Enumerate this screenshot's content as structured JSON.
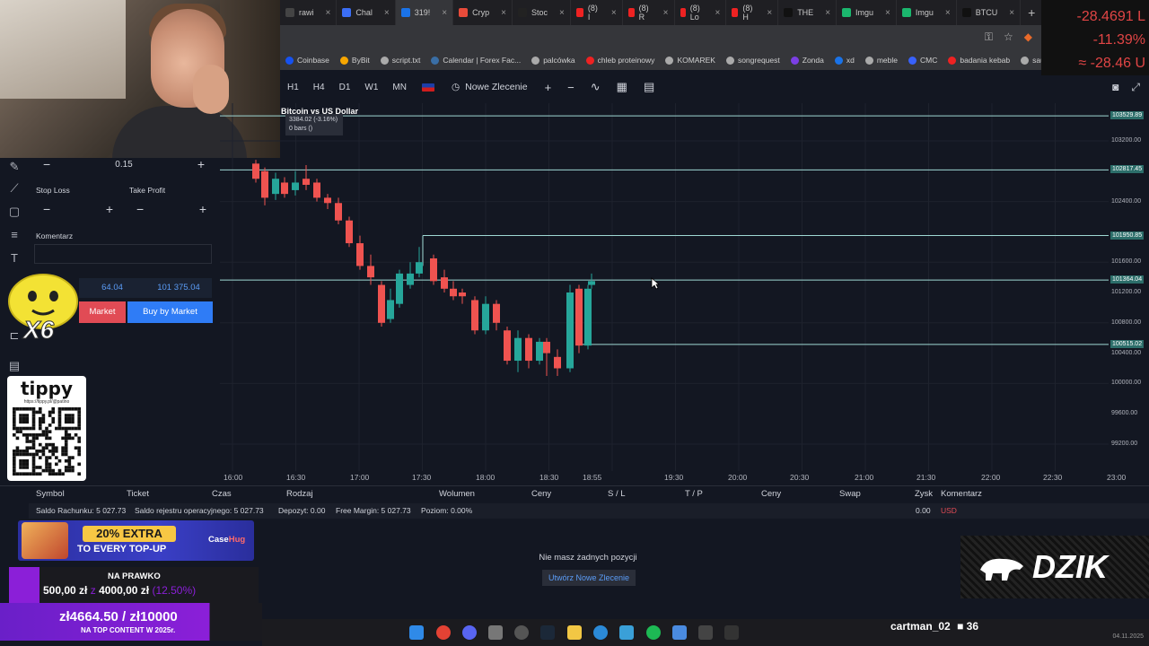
{
  "browser": {
    "tabs": [
      {
        "label": "rawi",
        "color": "#444"
      },
      {
        "label": "Chal",
        "color": "#3b6ef5"
      },
      {
        "label": "319!",
        "color": "#1a73e8",
        "active": true
      },
      {
        "label": "Cryp",
        "color": "#e84b3a"
      },
      {
        "label": "Stoc",
        "color": "#222"
      },
      {
        "label": "(8) I",
        "color": "#e22"
      },
      {
        "label": "(8) R",
        "color": "#e22"
      },
      {
        "label": "(8) Lo",
        "color": "#e22"
      },
      {
        "label": "(8) H",
        "color": "#e22"
      },
      {
        "label": "THE",
        "color": "#111"
      },
      {
        "label": "Imgu",
        "color": "#1bb76e"
      },
      {
        "label": "Imgu",
        "color": "#1bb76e"
      },
      {
        "label": "BTCU",
        "color": "#111"
      }
    ],
    "bookmarks": [
      {
        "label": "Coinbase",
        "color": "#1652f0"
      },
      {
        "label": "ByBit",
        "color": "#f7a600"
      },
      {
        "label": "script.txt",
        "color": "#aaa"
      },
      {
        "label": "Calendar | Forex Fac...",
        "color": "#3a6ea5"
      },
      {
        "label": "palcówka",
        "color": "#aaa"
      },
      {
        "label": "chleb proteinowy",
        "color": "#e22"
      },
      {
        "label": "KOMAREK",
        "color": "#aaa"
      },
      {
        "label": "songrequest",
        "color": "#aaa"
      },
      {
        "label": "Zonda",
        "color": "#7b3fe4"
      },
      {
        "label": "xd",
        "color": "#1a73e8"
      },
      {
        "label": "meble",
        "color": "#aaa"
      },
      {
        "label": "CMC",
        "color": "#3861fb"
      },
      {
        "label": "badania kebab",
        "color": "#e22"
      },
      {
        "label": "sauna",
        "color": "#aaa"
      }
    ]
  },
  "pnl": {
    "line1": "-28.4691 L",
    "line2": "-11.39%",
    "line3": "≈ -28.46 U"
  },
  "toolbar": {
    "timeframes": [
      "H1",
      "H4",
      "D1",
      "W1",
      "MN"
    ],
    "order_label": "Nowe Zlecenie"
  },
  "order_panel": {
    "volume": "0.15",
    "stop_loss_label": "Stop Loss",
    "take_profit_label": "Take Profit",
    "comment_label": "Komentarz",
    "sell_price": "64.04",
    "buy_price": "101 375.04",
    "sell_label": "Market",
    "buy_label": "Buy by Market"
  },
  "emote": {
    "multiplier": "X6"
  },
  "tippy": {
    "logo": "tippy",
    "url": "https://tippy.pl/@patino"
  },
  "chart": {
    "title": "Bitcoin vs US Dollar",
    "tooltip_line1": "3384.02 (-3.16%)",
    "tooltip_line2": "0 bars ()",
    "price_ticks": [
      "103200.00",
      "102400.00",
      "101600.00",
      "101200.00",
      "100800.00",
      "100400.00",
      "100000.00",
      "99600.00",
      "99200.00"
    ],
    "price_lines": [
      "103529.89",
      "102817.45",
      "101950.85",
      "101364.04",
      "100515.02"
    ],
    "time_ticks": [
      "16:00",
      "16:30",
      "17:00",
      "17:30",
      "18:00",
      "18:30",
      "18:55",
      "19:30",
      "20:00",
      "20:30",
      "21:00",
      "21:30",
      "22:00",
      "22:30",
      "23:00"
    ]
  },
  "positions": {
    "columns": [
      "Symbol",
      "Ticket",
      "Czas",
      "Rodzaj",
      "Wolumen",
      "Ceny",
      "S / L",
      "T / P",
      "Ceny",
      "Swap",
      "Zysk",
      "Komentarz"
    ],
    "saldo": "Saldo Rachunku: 5 027.73",
    "saldo_rejestru": "Saldo rejestru operacyjnego: 5 027.73",
    "depozyt": "Depozyt: 0.00",
    "free_margin": "Free Margin: 5 027.73",
    "poziom": "Poziom: 0.00%",
    "zysk": "0.00",
    "currency": "USD",
    "empty_message": "Nie masz żadnych pozycji",
    "new_order_button": "Utwórz Nowe Zlecenie"
  },
  "casehug": {
    "extra": "20% EXTRA",
    "topup": "TO EVERY TOP-UP",
    "brand_a": "Case",
    "brand_b": "Hug"
  },
  "goal1": {
    "title": "NA PRAWKO",
    "current": "500,00 zł",
    "sep": "z",
    "target": "4000,00 zł",
    "percent": "(12.50%)"
  },
  "goal2": {
    "amount": "zł4664.50 / zł10000",
    "subtitle": "NA TOP CONTENT W 2025r."
  },
  "dzik": {
    "text": "DZIK"
  },
  "taskbar": {
    "viewer": "cartman_02",
    "count": "36",
    "date": "04.11.2025"
  }
}
